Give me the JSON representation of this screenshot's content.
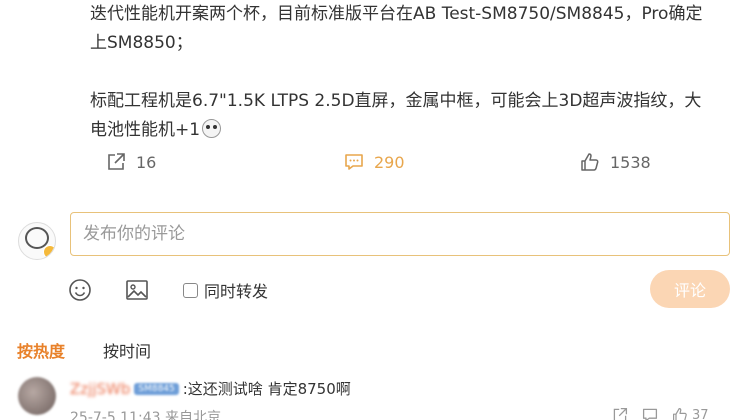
{
  "post": {
    "line1": "迭代性能机开案两个杯，目前标准版平台在AB Test-SM8750/SM8845，Pro确定",
    "line2": "上SM8850；",
    "line3": "标配工程机是6.7\"1.5K LTPS 2.5D直屏，金属中框，可能会上3D超声波指纹，大",
    "line4": "电池性能机+1"
  },
  "actions": {
    "share_count": "16",
    "comment_count": "290",
    "like_count": "1538"
  },
  "composer": {
    "placeholder": "发布你的评论",
    "forward_label": "同时转发",
    "submit_label": "评论"
  },
  "sort": {
    "hot_label": "按热度",
    "time_label": "按时间"
  },
  "comments": [
    {
      "text": ":这还测试啥  肯定8750啊",
      "meta": "25-7-5 11:43 来自北京",
      "like_count": "37"
    }
  ],
  "colors": {
    "accent_orange": "#e8812a",
    "comment_count_color": "#e8a64c",
    "submit_bg": "#fbd6b4",
    "input_border": "#e8c27a"
  }
}
